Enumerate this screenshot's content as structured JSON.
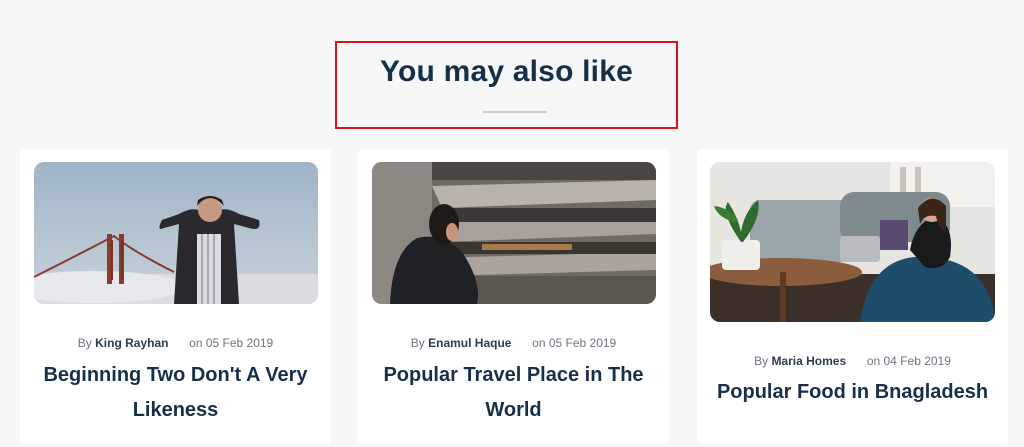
{
  "section": {
    "heading": "You may also like"
  },
  "posts": [
    {
      "by_label": "By",
      "author": "King Rayhan",
      "date": "on 05 Feb 2019",
      "title": "Beginning Two Don't A Very Likeness"
    },
    {
      "by_label": "By",
      "author": "Enamul Haque",
      "date": "on 05 Feb 2019",
      "title": "Popular Travel Place in The World"
    },
    {
      "by_label": "By",
      "author": "Maria Homes",
      "date": "on 04 Feb 2019",
      "title": "Popular Food in Bnagladesh"
    }
  ],
  "colors": {
    "background": "#f6f7f7",
    "heading": "#17304a",
    "highlight_border": "#d9141f"
  }
}
